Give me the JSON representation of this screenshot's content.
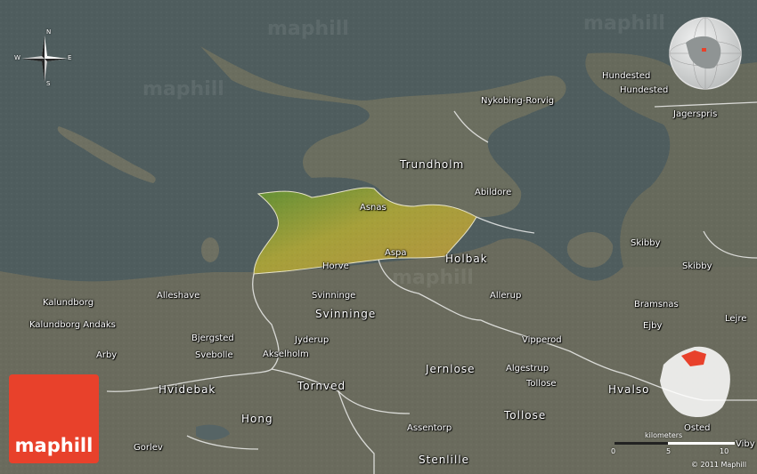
{
  "brand": {
    "logo_text": "maphill",
    "watermark": "maphill",
    "copyright": "© 2011 Maphill"
  },
  "compass": {
    "n": "N",
    "s": "S",
    "e": "E",
    "w": "W"
  },
  "scale": {
    "title": "kilometers",
    "ticks": [
      "0",
      "5",
      "10"
    ]
  },
  "colors": {
    "sea": "#4f5d5e",
    "land": "#6b6e5f",
    "highlight": "#a6a03a",
    "logo": "#e8412b",
    "inset_region": "#e8412b"
  },
  "labels": [
    {
      "id": "hundested-1",
      "text": "Hundested"
    },
    {
      "id": "hundested-2",
      "text": "Hundested"
    },
    {
      "id": "nykobing",
      "text": "Nykobing-Rorvig"
    },
    {
      "id": "jagerspris",
      "text": "Jagerspris"
    },
    {
      "id": "trundholm",
      "text": "Trundholm"
    },
    {
      "id": "abildore",
      "text": "Abildore"
    },
    {
      "id": "asnas",
      "text": "Asnas"
    },
    {
      "id": "skibby-1",
      "text": "Skibby"
    },
    {
      "id": "skibby-2",
      "text": "Skibby"
    },
    {
      "id": "aspa",
      "text": "Aspa"
    },
    {
      "id": "holbak",
      "text": "Holbak"
    },
    {
      "id": "horve",
      "text": "Horve"
    },
    {
      "id": "kalundborg-1",
      "text": "Kalundborg"
    },
    {
      "id": "alleshave",
      "text": "Alleshave"
    },
    {
      "id": "svinninge-1",
      "text": "Svinninge"
    },
    {
      "id": "allerup",
      "text": "Allerup"
    },
    {
      "id": "bramsnas",
      "text": "Bramsnas"
    },
    {
      "id": "lejre",
      "text": "Lejre"
    },
    {
      "id": "svinninge-2",
      "text": "Svinninge"
    },
    {
      "id": "kalundborg-andaks",
      "text": "Kalundborg Andaks"
    },
    {
      "id": "ejby",
      "text": "Ejby"
    },
    {
      "id": "bjergsted",
      "text": "Bjergsted"
    },
    {
      "id": "jyderup",
      "text": "Jyderup"
    },
    {
      "id": "vipperod",
      "text": "Vipperod"
    },
    {
      "id": "svebolle",
      "text": "Svebolle"
    },
    {
      "id": "akselholm",
      "text": "Akselholm"
    },
    {
      "id": "arby",
      "text": "Arby"
    },
    {
      "id": "jernlose",
      "text": "Jernlose"
    },
    {
      "id": "algestrup",
      "text": "Algestrup"
    },
    {
      "id": "tollose-1",
      "text": "Tollose"
    },
    {
      "id": "hvidebak",
      "text": "Hvidebak"
    },
    {
      "id": "tornved",
      "text": "Tornved"
    },
    {
      "id": "hvalso",
      "text": "Hvalso"
    },
    {
      "id": "hong",
      "text": "Hong"
    },
    {
      "id": "tollose-2",
      "text": "Tollose"
    },
    {
      "id": "assentorp",
      "text": "Assentorp"
    },
    {
      "id": "osted",
      "text": "Osted"
    },
    {
      "id": "gorlev",
      "text": "Gorlev"
    },
    {
      "id": "stenlille",
      "text": "Stenlille"
    },
    {
      "id": "viby",
      "text": "Viby"
    }
  ]
}
